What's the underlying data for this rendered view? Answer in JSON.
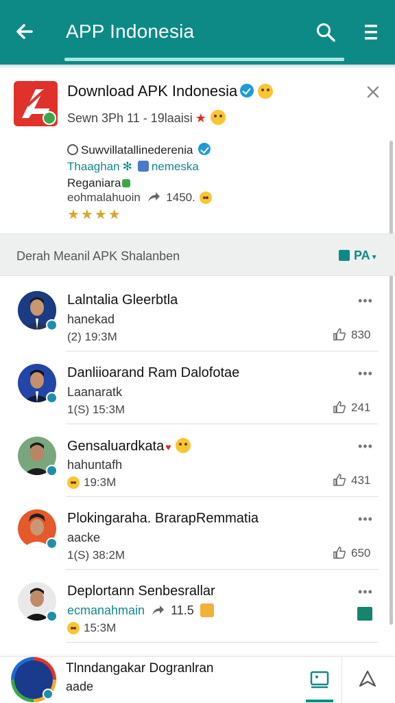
{
  "appbar": {
    "title": "APP Indonesia",
    "color": "#0e8a86"
  },
  "app": {
    "name": "Download APK Indonesia",
    "subtitle": "Sewn 3Ph 11 - 19laaisi",
    "desc_line1": "Suwvillatallinederenia",
    "desc_line2a": "Thaaghan",
    "desc_line2b": "nemeska",
    "desc_line3": "Reganiara",
    "desc_line4": "eohmalahuoin",
    "desc_line4_count": "1450.",
    "rating_stars": "★★★★",
    "rating": 4
  },
  "section": {
    "label": "Derah Meanil APK Shalanben",
    "sort_label": "PA"
  },
  "comments": [
    {
      "name": "Lalntalia Gleerbtla",
      "handle": "hanekad",
      "time": "(2) 19:3M",
      "likes": "830"
    },
    {
      "name": "Danliioarand Ram Dalofotae",
      "handle": "Laanaratk",
      "time": "1(S) 15:3M",
      "likes": "241"
    },
    {
      "name": "Gensaluardkata",
      "handle": "hahuntafh",
      "time": "19:3M",
      "likes": "431"
    },
    {
      "name": "Plokingaraha. BrarapRemmatia",
      "handle": "aacke",
      "time": "1(S) 38:2M",
      "likes": "650"
    },
    {
      "name": "Deplortann Senbesrallar",
      "handle": "ecmanahmain",
      "handle_suffix": "11.5",
      "time": "15:3M",
      "likes": ""
    }
  ],
  "composer": {
    "name": "Tlnndangakar Dogranlran",
    "handle": "aade"
  }
}
